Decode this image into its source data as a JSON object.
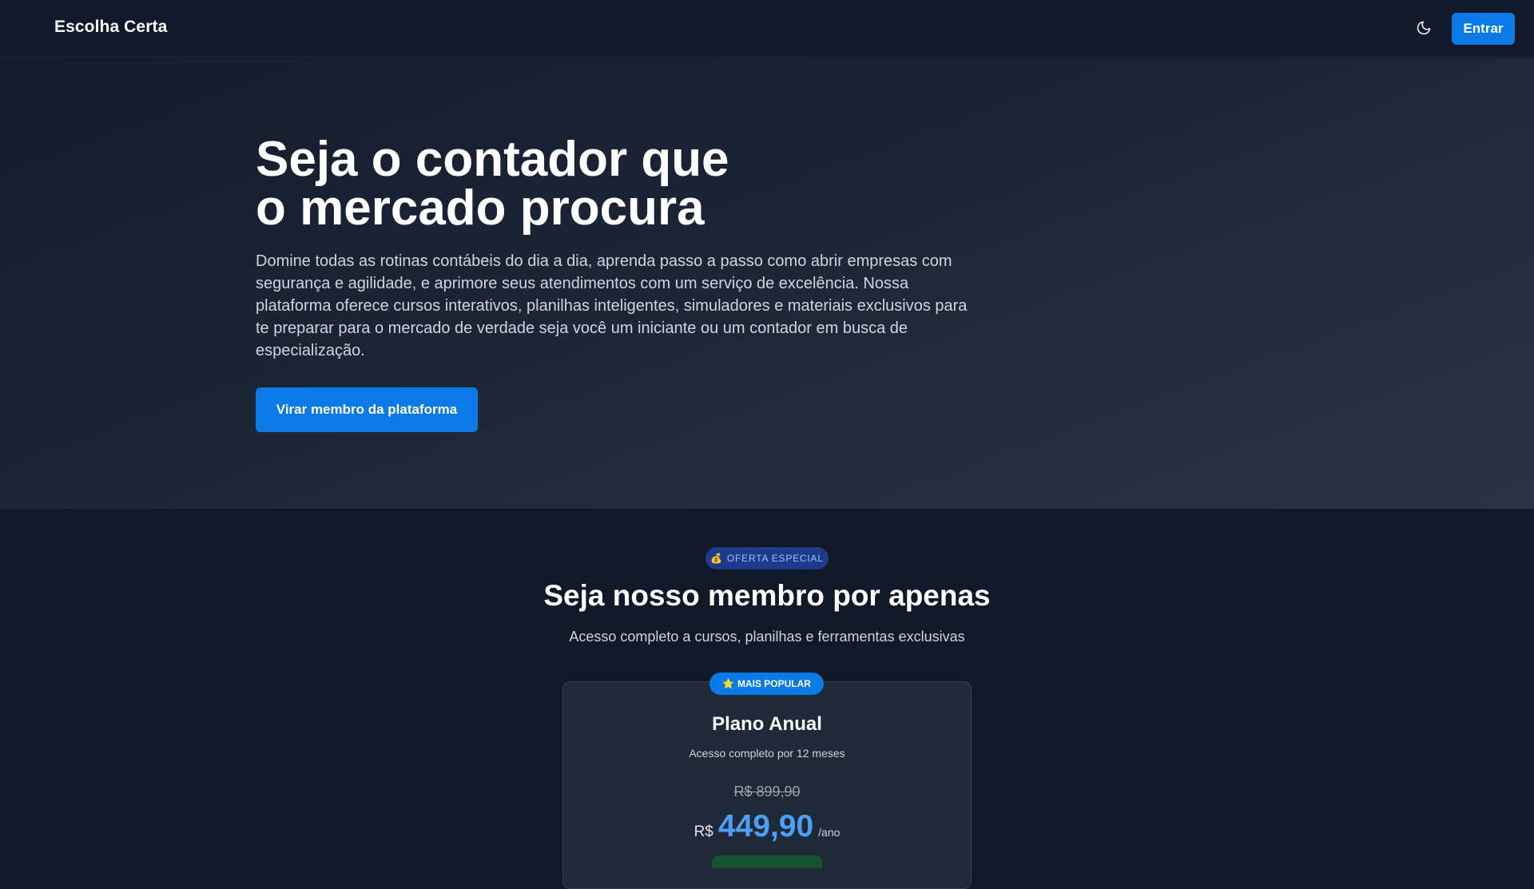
{
  "header": {
    "brand": "Escolha Certa",
    "theme_icon": "moon-icon",
    "login_label": "Entrar"
  },
  "hero": {
    "title_line1": "Seja o contador que",
    "title_line2": "o mercado procura",
    "description": "Domine todas as rotinas contábeis do dia a dia, aprenda passo a passo como abrir empresas com segurança e agilidade, e aprimore seus atendimentos com um serviço de excelência. Nossa plataforma oferece cursos interativos, planilhas inteligentes, simuladores e materiais exclusivos para te preparar para o mercado de verdade seja você um iniciante ou um contador em busca de especialização.",
    "cta_label": "Virar membro da plataforma"
  },
  "pricing": {
    "badge_icon": "money-bag-icon",
    "badge_label": "OFERTA ESPECIAL",
    "title": "Seja nosso membro por apenas",
    "subtitle": "Acesso completo a cursos, planilhas e ferramentas exclusivas",
    "plan": {
      "popular_icon": "star-icon",
      "popular_label": "MAIS POPULAR",
      "name": "Plano Anual",
      "description": "Acesso completo por 12 meses",
      "old_price": "R$ 899,90",
      "currency": "R$",
      "price": "449,90",
      "period": "/ano"
    }
  },
  "colors": {
    "background": "#111827",
    "accent": "#0b7ae6",
    "price": "#4b9ff5",
    "badge_bg": "#1e3a8a"
  }
}
